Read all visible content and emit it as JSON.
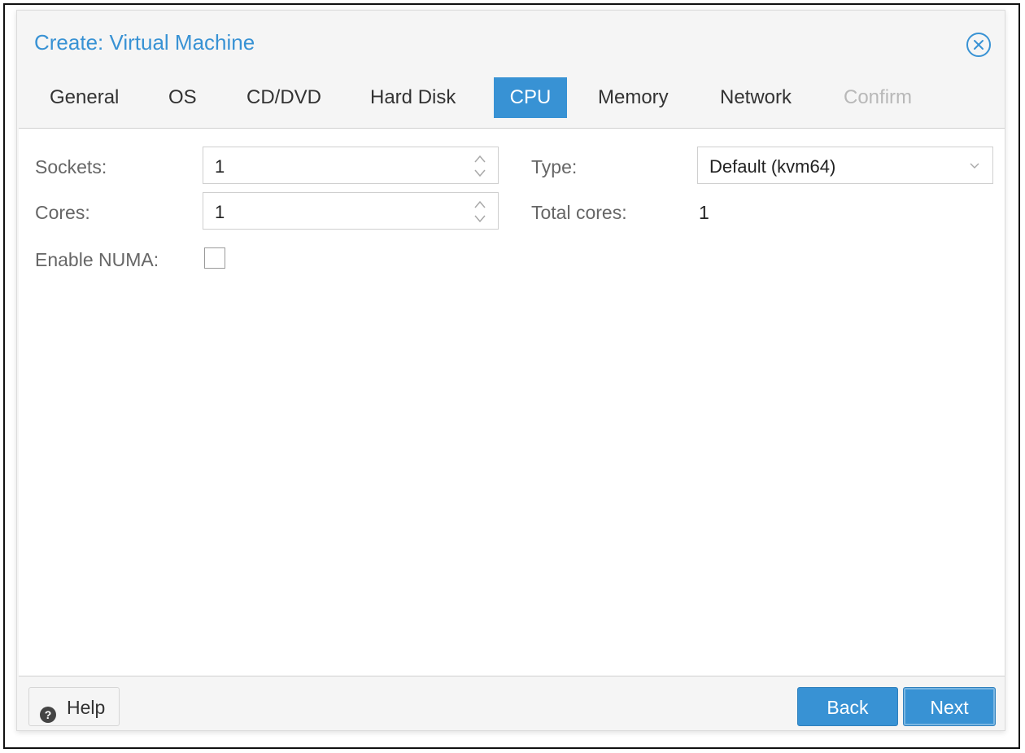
{
  "window": {
    "title": "Create: Virtual Machine"
  },
  "tabs": [
    {
      "label": "General",
      "state": "normal"
    },
    {
      "label": "OS",
      "state": "normal"
    },
    {
      "label": "CD/DVD",
      "state": "normal"
    },
    {
      "label": "Hard Disk",
      "state": "normal"
    },
    {
      "label": "CPU",
      "state": "active"
    },
    {
      "label": "Memory",
      "state": "normal"
    },
    {
      "label": "Network",
      "state": "normal"
    },
    {
      "label": "Confirm",
      "state": "disabled"
    }
  ],
  "form": {
    "sockets": {
      "label": "Sockets:",
      "value": "1"
    },
    "cores": {
      "label": "Cores:",
      "value": "1"
    },
    "numa": {
      "label": "Enable NUMA:",
      "checked": false
    },
    "type": {
      "label": "Type:",
      "value": "Default (kvm64)"
    },
    "total_cores": {
      "label": "Total cores:",
      "value": "1"
    }
  },
  "footer": {
    "help_label": "Help",
    "back_label": "Back",
    "next_label": "Next"
  },
  "colors": {
    "accent": "#3892d4",
    "disabled_text": "#b8b8b8",
    "label_text": "#666666"
  },
  "icons": {
    "close": "close-circle-icon",
    "help": "question-circle-icon",
    "spinner": "spinner-arrows-icon",
    "dropdown": "chevron-down-icon"
  }
}
